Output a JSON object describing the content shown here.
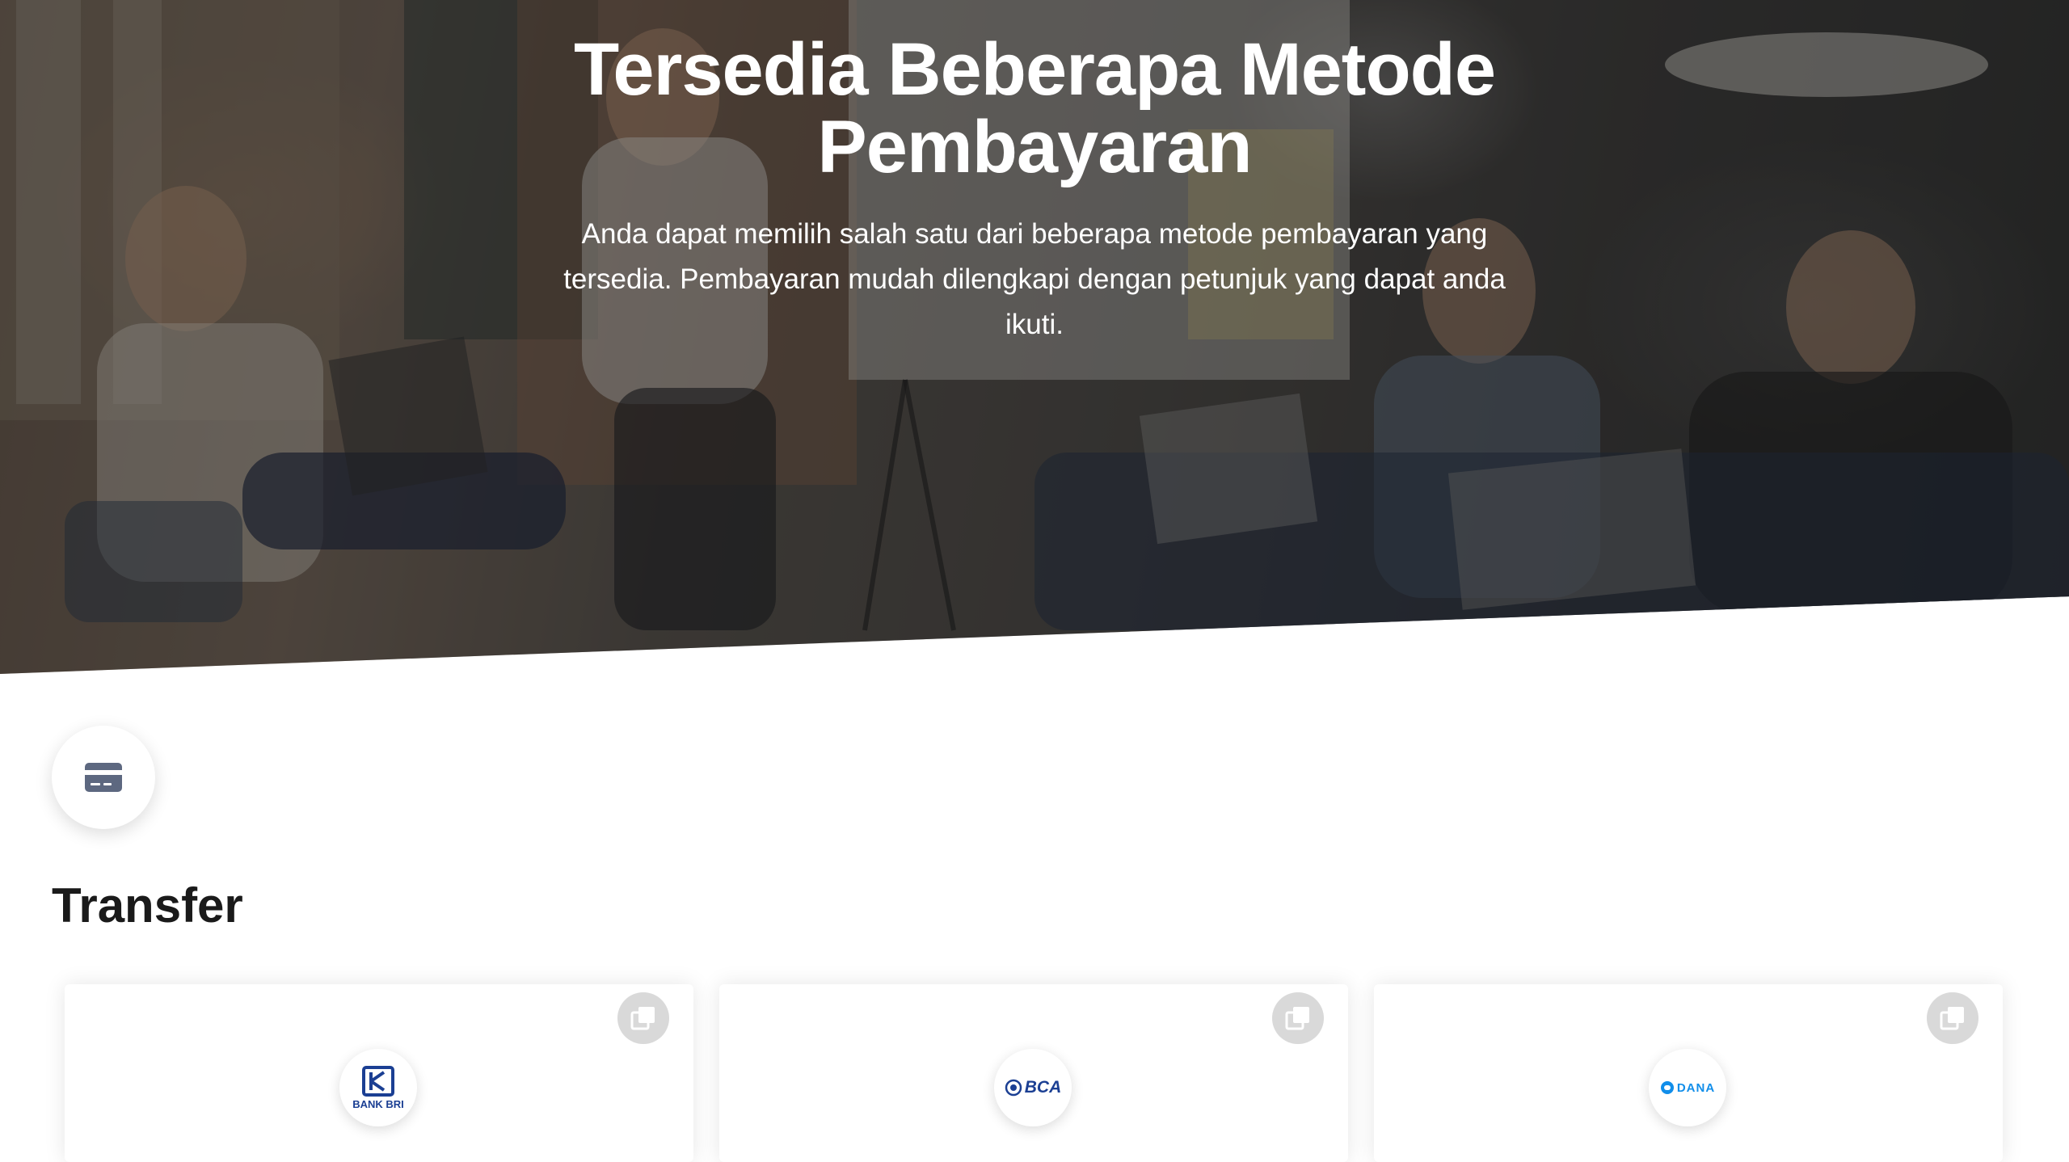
{
  "hero": {
    "title": "Tersedia Beberapa Metode Pembayaran",
    "subtitle": "Anda dapat memilih salah satu dari beberapa metode pembayaran yang tersedia. Pembayaran mudah dilengkapi dengan petunjuk yang dapat anda ikuti."
  },
  "section": {
    "icon": "credit-card-icon",
    "title": "Transfer"
  },
  "payment_methods": [
    {
      "logo_text": "BANK BRI",
      "logo_icon": "bri-logo",
      "copy_icon": "copy-icon",
      "brand_color": "#1b3f93"
    },
    {
      "logo_text": "BCA",
      "logo_icon": "bca-logo",
      "copy_icon": "copy-icon",
      "brand_color": "#1b3f93"
    },
    {
      "logo_text": "DANA",
      "logo_icon": "dana-logo",
      "copy_icon": "copy-icon",
      "brand_color": "#118eea"
    }
  ],
  "colors": {
    "heading": "#1a1a1a",
    "icon_gray": "#5d6880",
    "copy_button": "#d9d9d9"
  }
}
